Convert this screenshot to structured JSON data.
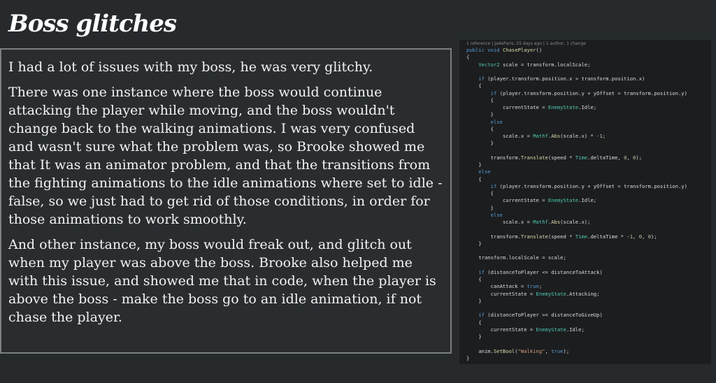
{
  "slide": {
    "title": "Boss glitches",
    "paragraphs": [
      "I had a lot of issues with my boss, he was very glitchy.",
      "There was one instance where the boss would continue attacking the player while moving, and the boss wouldn't change back to the walking animations. I was very confused and wasn't sure what the problem was, so Brooke showed me that It was an animator problem, and that the transitions from the fighting animations to the idle animations where set to idle - false, so we just had to get rid of those conditions, in order for those animations to work smoothly.",
      "And other instance, my boss would freak out, and glitch out when my player was above the boss. Brooke also helped me with this issue, and showed me that in code, when the player is above the boss - make the boss go to an idle animation, if not chase the player."
    ]
  },
  "code": {
    "meta": "1 reference | JadeParis, 55 days ago | 1 author, 1 change",
    "lines": [
      "public void ChasePlayer()",
      "{",
      "    Vector2 scale = transform.localScale;",
      "",
      "    if (player.transform.position.x > transform.position.x)",
      "    {",
      "        if (player.transform.position.y + yOffset > transform.position.y)",
      "        {",
      "            currentState = EnemyState.Idle;",
      "        }",
      "        else",
      "        {",
      "            scale.x = Mathf.Abs(scale.x) * -1;",
      "        }",
      "",
      "        transform.Translate(speed * Time.deltaTime, 0, 0);",
      "    }",
      "    else",
      "    {",
      "        if (player.transform.position.y + yOffset > transform.position.y)",
      "        {",
      "            currentState = EnemyState.Idle;",
      "        }",
      "        else",
      "            scale.x = Mathf.Abs(scale.x);",
      "",
      "        transform.Translate(speed * Time.deltaTime * -1, 0, 0);",
      "    }",
      "",
      "    transform.localScale = scale;",
      "",
      "    if (distanceToPlayer <= distanceToAttack)",
      "    {",
      "        canAttack = true;",
      "        currentState = EnemyState.Attacking;",
      "    }",
      "",
      "    if (distanceToPlayer >= distanceToGiveUp)",
      "    {",
      "        currentState = EnemyState.Idle;",
      "    }",
      "",
      "    anim.SetBool(\"Walking\", true);",
      "}"
    ],
    "colors": {
      "keyword": "#569cd6",
      "type": "#4ec9b0",
      "method": "#dcdcaa",
      "string": "#d69d85",
      "number": "#b5cea8",
      "plain": "#dcdcdc"
    }
  }
}
